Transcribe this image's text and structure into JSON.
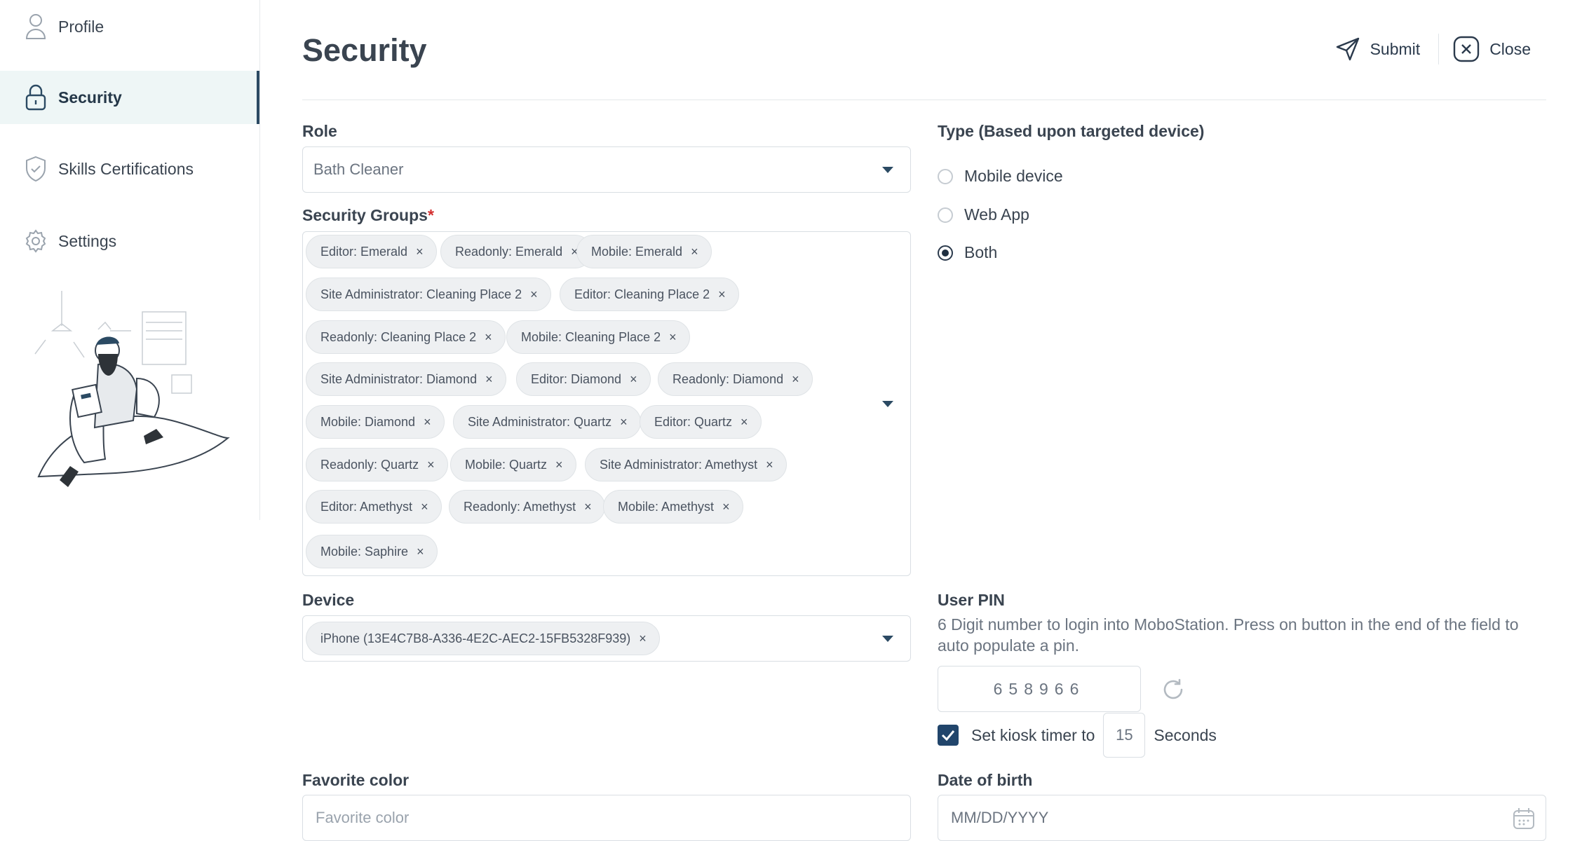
{
  "sidebar": {
    "items": [
      {
        "label": "Profile",
        "icon": "user-icon"
      },
      {
        "label": "Security",
        "icon": "lock-icon",
        "active": true
      },
      {
        "label": "Skills Certifications",
        "icon": "shield-check-icon"
      },
      {
        "label": "Settings",
        "icon": "gear-icon"
      }
    ]
  },
  "header": {
    "title": "Security",
    "submit_label": "Submit",
    "close_label": "Close"
  },
  "role": {
    "label": "Role",
    "value": "Bath Cleaner"
  },
  "security_groups": {
    "label": "Security Groups",
    "required_mark": "*",
    "chips": [
      "Editor: Emerald",
      "Readonly: Emerald",
      "Mobile: Emerald",
      "Site Administrator: Cleaning Place 2",
      "Editor: Cleaning Place 2",
      "Readonly: Cleaning Place 2",
      "Mobile: Cleaning Place 2",
      "Site Administrator: Diamond",
      "Editor: Diamond",
      "Readonly: Diamond",
      "Mobile: Diamond",
      "Site Administrator: Quartz",
      "Editor: Quartz",
      "Readonly: Quartz",
      "Mobile: Quartz",
      "Site Administrator: Amethyst",
      "Editor: Amethyst",
      "Readonly: Amethyst",
      "Mobile: Amethyst",
      "Mobile: Saphire"
    ],
    "remove_glyph": "×"
  },
  "type": {
    "label": "Type (Based upon targeted device)",
    "options": [
      {
        "label": "Mobile device",
        "checked": false
      },
      {
        "label": "Web App",
        "checked": false
      },
      {
        "label": "Both",
        "checked": true
      }
    ]
  },
  "device": {
    "label": "Device",
    "chip": "iPhone (13E4C7B8-A336-4E2C-AEC2-15FB5328F939)"
  },
  "user_pin": {
    "label": "User PIN",
    "help": "6 Digit number to login into MoboStation. Press on button in the end of the field to auto populate a pin.",
    "value": "658966",
    "kiosk_prefix": "Set kiosk timer to",
    "kiosk_value": "15",
    "kiosk_suffix": "Seconds",
    "kiosk_checked": true
  },
  "favorite_color": {
    "label": "Favorite color",
    "placeholder": "Favorite color"
  },
  "date_of_birth": {
    "label": "Date of birth",
    "placeholder": "MM/DD/YYYY"
  },
  "colors": {
    "accent": "#21456b",
    "active_bg": "#eef6f6",
    "required": "#d32f2f"
  }
}
